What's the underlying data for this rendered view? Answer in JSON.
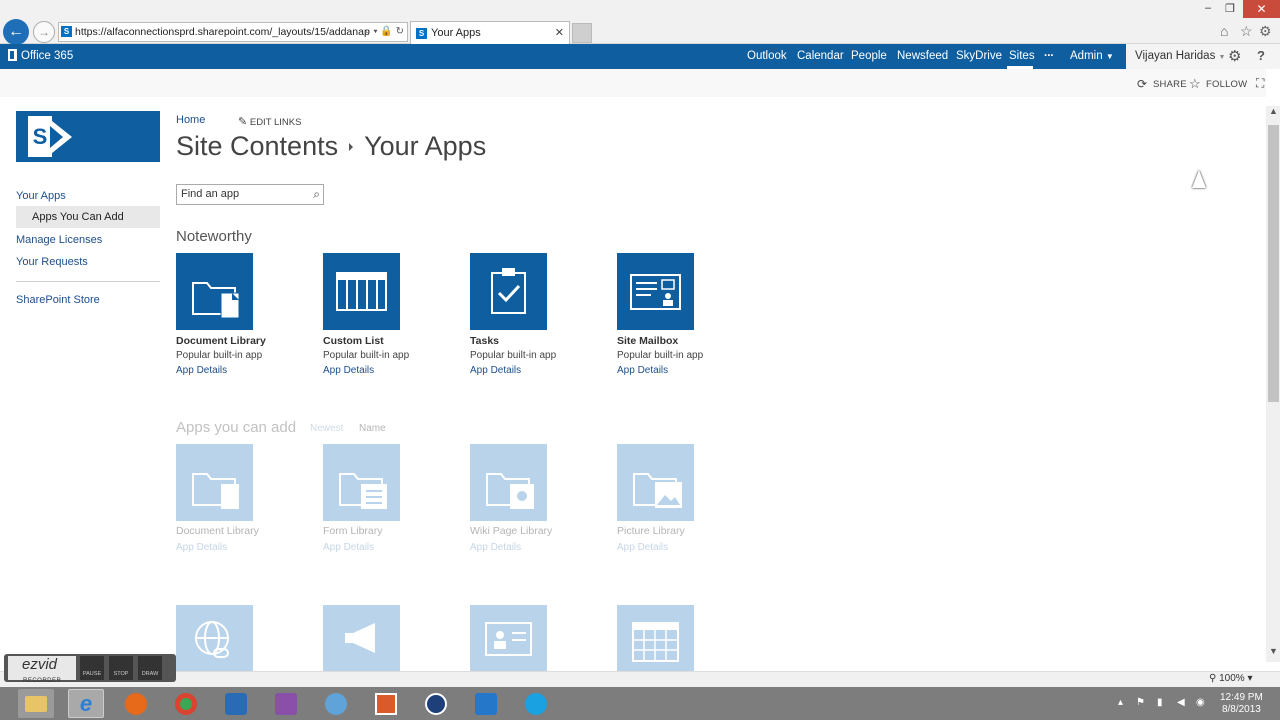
{
  "browser": {
    "url": "https://alfaconnectionsprd.sharepoint.com/_layouts/15/addanap",
    "url_controls": "⌕ ▾ 🔒 ↻",
    "tab_title": "Your Apps"
  },
  "suite_bar": {
    "brand": "Office 365",
    "links": [
      "Outlook",
      "Calendar",
      "People",
      "Newsfeed",
      "SkyDrive",
      "Sites",
      "...",
      "Admin"
    ],
    "user": "Vijayan Haridas"
  },
  "share_row": {
    "share": "SHARE",
    "follow": "FOLLOW"
  },
  "left_nav": {
    "items": [
      "Your Apps",
      "Apps You Can Add",
      "Manage Licenses",
      "Your Requests",
      "SharePoint Store"
    ]
  },
  "breadcrumb": {
    "home": "Home",
    "edit_links": "EDIT LINKS"
  },
  "title": {
    "part1": "Site Contents",
    "part2": "Your Apps"
  },
  "search": {
    "placeholder": "Find an app"
  },
  "noteworthy": {
    "heading": "Noteworthy",
    "apps": [
      {
        "name": "Document Library",
        "sub": "Popular built-in app",
        "link": "App Details"
      },
      {
        "name": "Custom List",
        "sub": "Popular built-in app",
        "link": "App Details"
      },
      {
        "name": "Tasks",
        "sub": "Popular built-in app",
        "link": "App Details"
      },
      {
        "name": "Site Mailbox",
        "sub": "Popular built-in app",
        "link": "App Details"
      }
    ]
  },
  "apps_you_can_add": {
    "heading": "Apps you can add",
    "sort_newest": "Newest",
    "sort_name": "Name",
    "apps": [
      {
        "name": "Document Library",
        "link": "App Details"
      },
      {
        "name": "Form Library",
        "link": "App Details"
      },
      {
        "name": "Wiki Page Library",
        "link": "App Details"
      },
      {
        "name": "Picture Library",
        "link": "App Details"
      }
    ]
  },
  "status": {
    "zoom": "100%"
  },
  "recorder": {
    "brand": "ezvid",
    "sub": "RECORDER",
    "buttons": [
      "PAUSE",
      "STOP",
      "DRAW"
    ]
  },
  "taskbar": {
    "time": "12:49 PM",
    "date": "8/8/2013"
  }
}
